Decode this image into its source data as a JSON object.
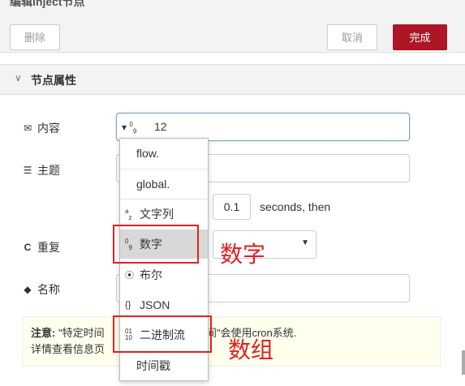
{
  "tray": {
    "title": "编辑inject节点"
  },
  "toolbar": {
    "delete_label": "删除",
    "cancel_label": "取消",
    "done_label": "完成"
  },
  "section": {
    "title": "节点属性"
  },
  "fields": {
    "payload_label": "内容",
    "payload_type_icon": "0-9",
    "payload_value": "12",
    "topic_label": "主题",
    "delay_value": "0.1",
    "delay_suffix": "seconds, then",
    "repeat_label": "重复",
    "name_label": "名称"
  },
  "note": {
    "bold": "注意:",
    "text1": "\"特定时间",
    "text2": "时间\"会使用cron系统.",
    "text3": "详情查看信息页"
  },
  "dropdown": {
    "items": [
      {
        "icon": "",
        "label": "flow."
      },
      {
        "icon": "",
        "label": "global."
      },
      {
        "icon": "a-z",
        "label": "文字列"
      },
      {
        "icon": "0-9",
        "label": "数字"
      },
      {
        "icon": "⦿",
        "label": "布尔"
      },
      {
        "icon": "{}",
        "label": "JSON"
      },
      {
        "icon": "01/10",
        "label": "二进制流"
      },
      {
        "icon": "",
        "label": "时间戳"
      }
    ]
  },
  "annotations": {
    "number": "数字",
    "array": "数组"
  },
  "colors": {
    "primary": "#ad1625",
    "highlight": "#e02020"
  }
}
